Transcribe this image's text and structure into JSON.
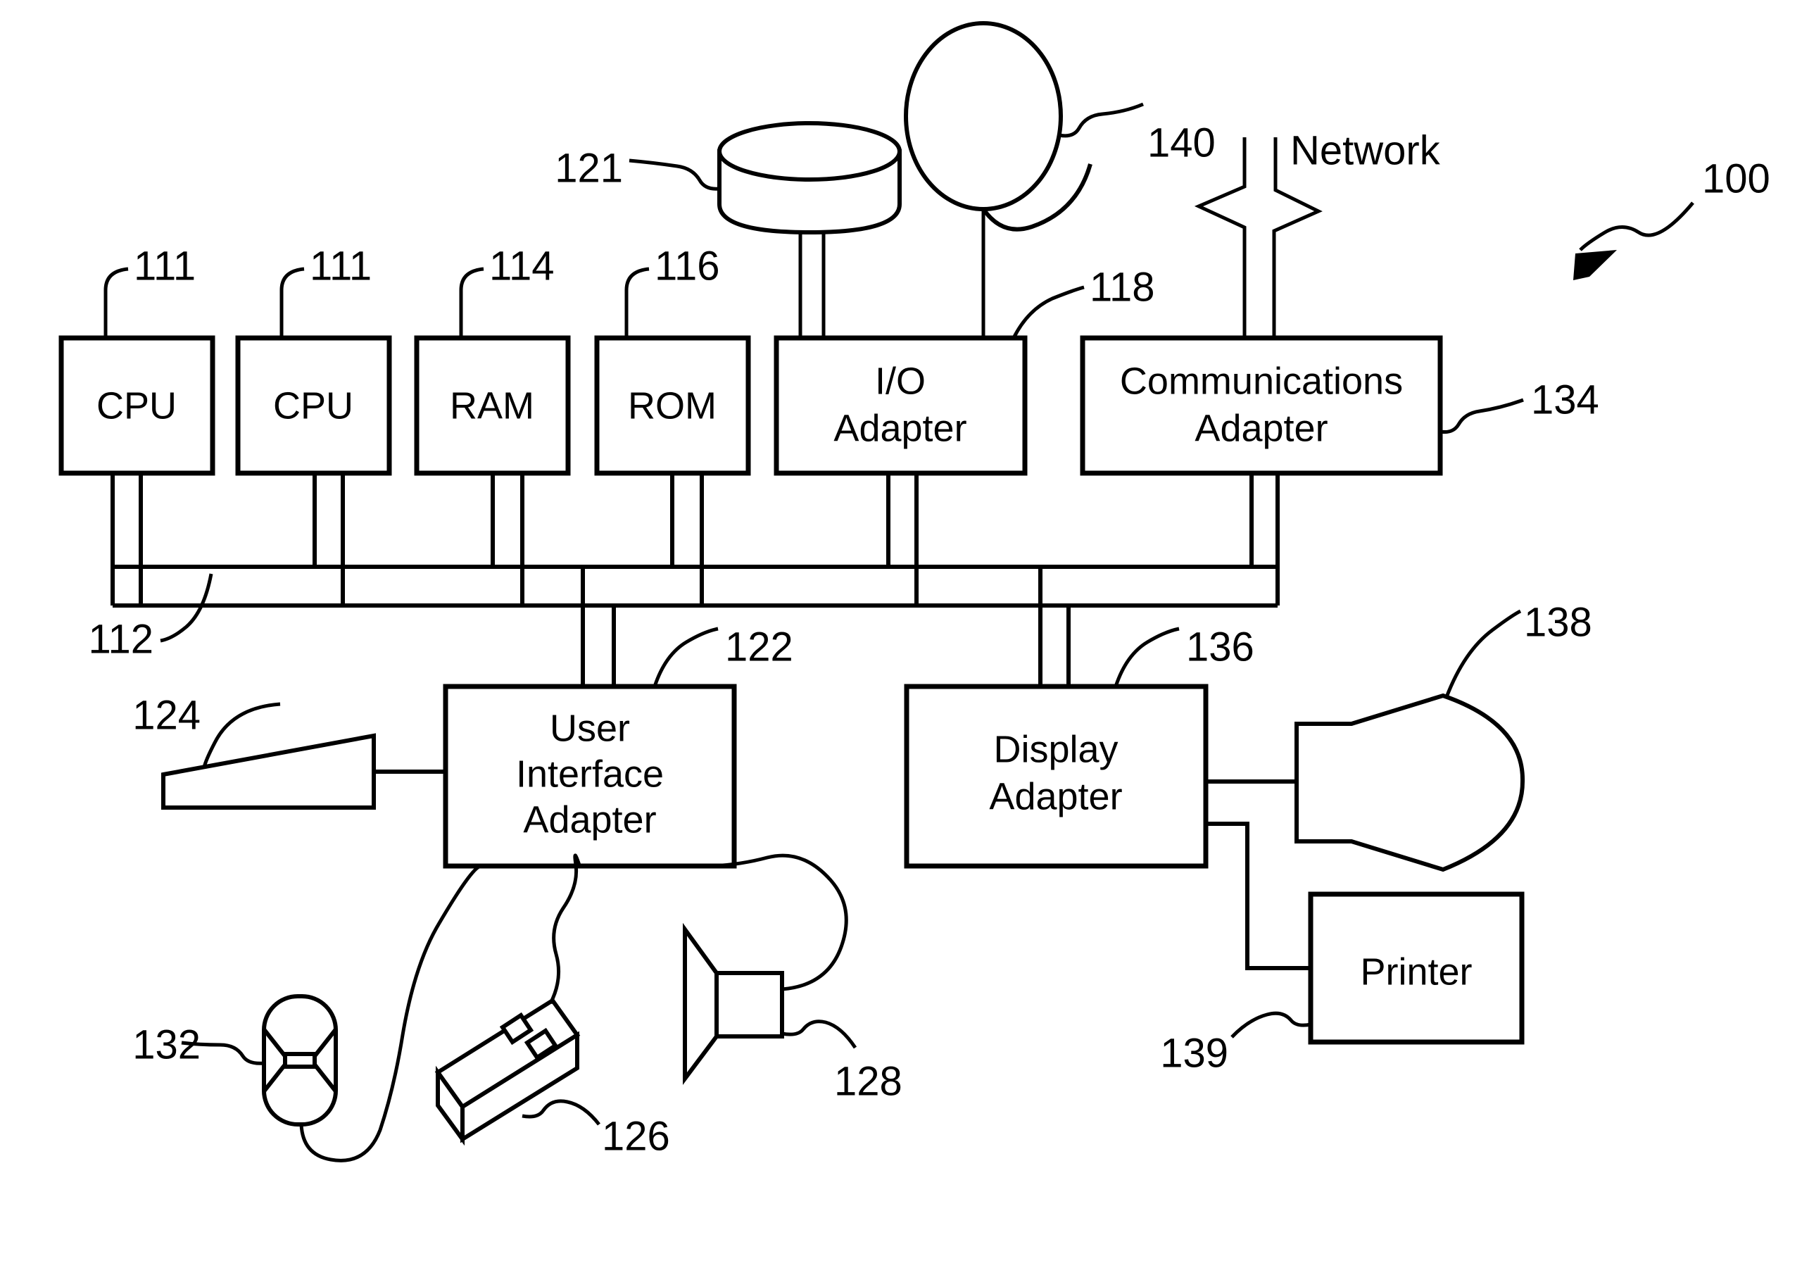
{
  "figure": {
    "figure_ref": "100",
    "network_label": "Network"
  },
  "blocks": [
    {
      "id": "cpu1",
      "label": "CPU",
      "ref": "111"
    },
    {
      "id": "cpu2",
      "label": "CPU",
      "ref": "111"
    },
    {
      "id": "ram",
      "label": "RAM",
      "ref": "114"
    },
    {
      "id": "rom",
      "label": "ROM",
      "ref": "116"
    },
    {
      "id": "ioad",
      "label_line1": "I/O",
      "label_line2": "Adapter",
      "ref": "118"
    },
    {
      "id": "commad",
      "label_line1": "Communications",
      "label_line2": "Adapter",
      "ref": "134"
    },
    {
      "id": "uiad",
      "label_line1": "User",
      "label_line2": "Interface",
      "label_line3": "Adapter",
      "ref": "122"
    },
    {
      "id": "dispad",
      "label_line1": "Display",
      "label_line2": "Adapter",
      "ref": "136"
    },
    {
      "id": "printer",
      "label": "Printer",
      "ref": "139"
    }
  ],
  "peripherals": [
    {
      "id": "disk",
      "ref": "121",
      "kind": "disk-drive-icon"
    },
    {
      "id": "tape",
      "ref": "140",
      "kind": "tape-reel-icon"
    },
    {
      "id": "keyboard",
      "ref": "124",
      "kind": "keyboard-icon"
    },
    {
      "id": "trackball",
      "ref": "132",
      "kind": "trackball-icon"
    },
    {
      "id": "mouse",
      "ref": "126",
      "kind": "mouse-icon"
    },
    {
      "id": "speaker",
      "ref": "128",
      "kind": "speaker-icon"
    },
    {
      "id": "monitor",
      "ref": "138",
      "kind": "crt-display-icon"
    }
  ],
  "bus": {
    "ref": "112",
    "name": "system-bus"
  },
  "refs": {
    "cpu1": "111",
    "cpu2": "111",
    "ram": "114",
    "rom": "116",
    "disk": "121",
    "tape": "140",
    "ioad": "118",
    "commad": "134",
    "bus": "112",
    "uiad": "122",
    "keyboard": "124",
    "trackball": "132",
    "mouse": "126",
    "speaker": "128",
    "dispad": "136",
    "monitor": "138",
    "printer": "139",
    "figure": "100"
  },
  "labels": {
    "cpu": "CPU",
    "ram": "RAM",
    "rom": "ROM",
    "io_l1": "I/O",
    "io_l2": "Adapter",
    "comm_l1": "Communications",
    "comm_l2": "Adapter",
    "ui_l1": "User",
    "ui_l2": "Interface",
    "ui_l3": "Adapter",
    "disp_l1": "Display",
    "disp_l2": "Adapter",
    "printer": "Printer",
    "network": "Network"
  }
}
